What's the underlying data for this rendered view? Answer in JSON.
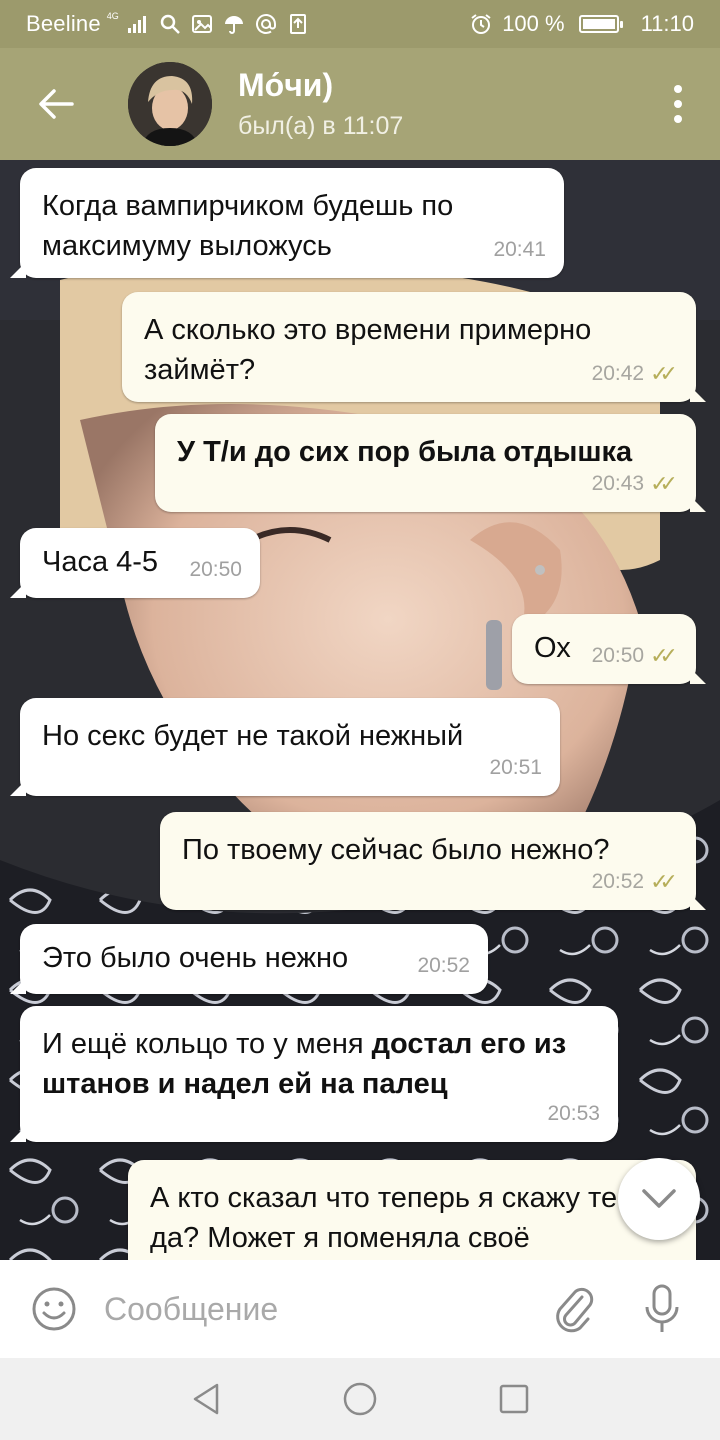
{
  "statusbar": {
    "carrier": "Beeline",
    "network": "4G",
    "battery": "100 %",
    "battery_level": 1.0,
    "time": "11:10"
  },
  "header": {
    "title": "Мо́чи)",
    "status": "был(а) в 11:07"
  },
  "messages": [
    {
      "dir": "in",
      "text": "Когда вампирчиком будешь по максимуму выложусь",
      "time": "20:41"
    },
    {
      "dir": "out",
      "text": "А сколько это времени примерно займёт?",
      "time": "20:42"
    },
    {
      "dir": "out",
      "text": "У Т/и до сих пор была отдышка",
      "time": "20:43",
      "bold": true
    },
    {
      "dir": "in",
      "text": "Часа 4-5",
      "time": "20:50"
    },
    {
      "dir": "out",
      "text": "Ох",
      "time": "20:50"
    },
    {
      "dir": "in",
      "text": "Но секс будет не такой нежный",
      "time": "20:51"
    },
    {
      "dir": "out",
      "text": "По твоему сейчас было нежно?",
      "time": "20:52"
    },
    {
      "dir": "in",
      "text": "Это было очень нежно",
      "time": "20:52"
    },
    {
      "dir": "in",
      "text_plain": "И ещё кольцо то у меня",
      "text_bold": "достал его из штанов и надел ей на палец",
      "time": "20:53"
    },
    {
      "dir": "out",
      "text": "А кто сказал что теперь я скажу тебе да? Может я поменяла своё"
    }
  ],
  "input": {
    "placeholder": "Сообщение"
  },
  "icons": {
    "back": "arrow-left-icon",
    "menu": "more-vertical-icon",
    "emoji": "smile-icon",
    "attach": "paperclip-icon",
    "mic": "microphone-icon",
    "scroll": "chevron-down-icon"
  },
  "colors": {
    "header": "#a6a476",
    "statusbar": "#9c9a6c",
    "incoming": "#ffffff",
    "outgoing": "#fdfbee",
    "ticks": "#b6ae5a"
  }
}
